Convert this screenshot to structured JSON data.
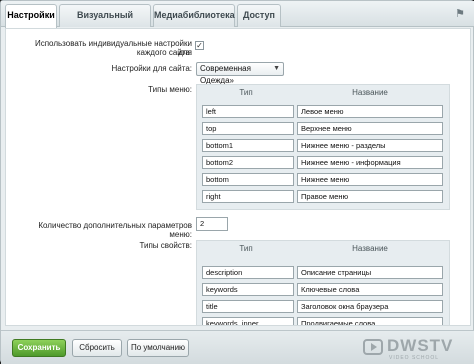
{
  "tabs": [
    "Настройки",
    "Визуальный редактор",
    "Медиабиблиотека",
    "Доступ"
  ],
  "pin_icon": "pin-icon",
  "settings": {
    "individual_label_line1": "Использовать индивидуальные настройки для",
    "individual_label_line2": "каждого сайта:",
    "individual_checked": true,
    "site_label": "Настройки для сайта:",
    "site_value": "Современная Одежда»"
  },
  "menu_types": {
    "label": "Типы меню:",
    "col_type": "Тип",
    "col_name": "Название",
    "rows": [
      {
        "type": "left",
        "name": "Левое меню"
      },
      {
        "type": "top",
        "name": "Верхнее меню"
      },
      {
        "type": "bottom1",
        "name": "Нижнее меню - разделы"
      },
      {
        "type": "bottom2",
        "name": "Нижнее меню - информация"
      },
      {
        "type": "bottom",
        "name": "Нижнее меню"
      },
      {
        "type": "right",
        "name": "Правое меню"
      }
    ]
  },
  "extra_params": {
    "label": "Количество дополнительных параметров меню:",
    "value": "2"
  },
  "property_types": {
    "label": "Типы свойств:",
    "col_type": "Тип",
    "col_name": "Название",
    "rows": [
      {
        "type": "description",
        "name": "Описание страницы"
      },
      {
        "type": "keywords",
        "name": "Ключевые слова"
      },
      {
        "type": "title",
        "name": "Заголовок окна браузера"
      },
      {
        "type": "keywords_inner",
        "name": "Продвигаемые слова"
      }
    ]
  },
  "footer": {
    "save": "Сохранить",
    "reset": "Сбросить",
    "default": "По умолчанию"
  },
  "watermark": {
    "brand": "DWSTV",
    "sub": "VIDEO SCHOOL"
  }
}
